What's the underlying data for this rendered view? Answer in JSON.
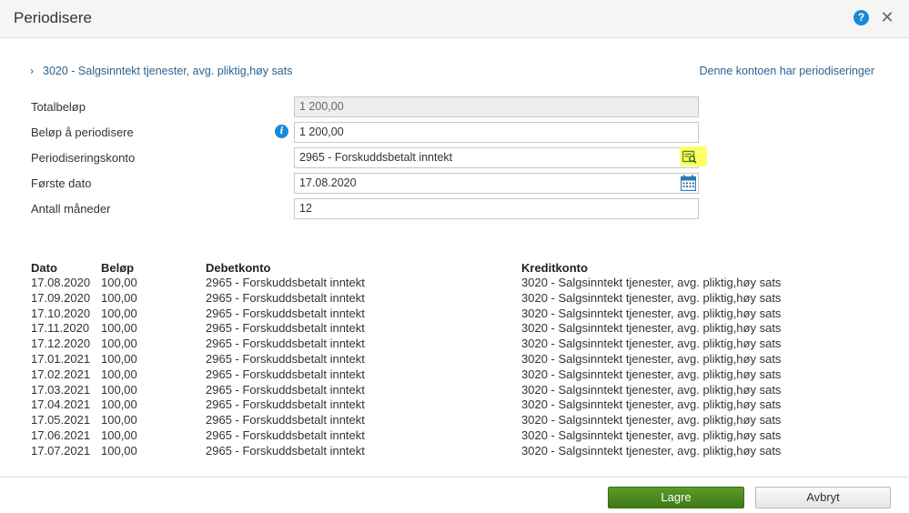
{
  "dialog": {
    "title": "Periodisere",
    "help_icon": "question-circle-icon",
    "close_icon": "close-icon"
  },
  "account": {
    "label": "3020 - Salgsinntekt tjenester, avg. pliktig,høy sats",
    "periodization_link": "Denne kontoen har periodiseringer"
  },
  "form": {
    "total_label": "Totalbeløp",
    "total_value": "1 200,00",
    "amount_label": "Beløp å periodisere",
    "amount_value": "1 200,00",
    "account_label": "Periodiseringskonto",
    "account_value": "2965 - Forskuddsbetalt inntekt",
    "first_date_label": "Første dato",
    "first_date_value": "17.08.2020",
    "months_label": "Antall måneder",
    "months_value": "12",
    "lookup_highlight_color": "#ffff66"
  },
  "table": {
    "headers": {
      "date": "Dato",
      "amount": "Beløp",
      "debit": "Debetkonto",
      "credit": "Kreditkonto"
    },
    "rows": [
      {
        "date": "17.08.2020",
        "amount": "100,00",
        "debit": "2965 - Forskuddsbetalt inntekt",
        "credit": "3020 - Salgsinntekt tjenester, avg. pliktig,høy sats"
      },
      {
        "date": "17.09.2020",
        "amount": "100,00",
        "debit": "2965 - Forskuddsbetalt inntekt",
        "credit": "3020 - Salgsinntekt tjenester, avg. pliktig,høy sats"
      },
      {
        "date": "17.10.2020",
        "amount": "100,00",
        "debit": "2965 - Forskuddsbetalt inntekt",
        "credit": "3020 - Salgsinntekt tjenester, avg. pliktig,høy sats"
      },
      {
        "date": "17.11.2020",
        "amount": "100,00",
        "debit": "2965 - Forskuddsbetalt inntekt",
        "credit": "3020 - Salgsinntekt tjenester, avg. pliktig,høy sats"
      },
      {
        "date": "17.12.2020",
        "amount": "100,00",
        "debit": "2965 - Forskuddsbetalt inntekt",
        "credit": "3020 - Salgsinntekt tjenester, avg. pliktig,høy sats"
      },
      {
        "date": "17.01.2021",
        "amount": "100,00",
        "debit": "2965 - Forskuddsbetalt inntekt",
        "credit": "3020 - Salgsinntekt tjenester, avg. pliktig,høy sats"
      },
      {
        "date": "17.02.2021",
        "amount": "100,00",
        "debit": "2965 - Forskuddsbetalt inntekt",
        "credit": "3020 - Salgsinntekt tjenester, avg. pliktig,høy sats"
      },
      {
        "date": "17.03.2021",
        "amount": "100,00",
        "debit": "2965 - Forskuddsbetalt inntekt",
        "credit": "3020 - Salgsinntekt tjenester, avg. pliktig,høy sats"
      },
      {
        "date": "17.04.2021",
        "amount": "100,00",
        "debit": "2965 - Forskuddsbetalt inntekt",
        "credit": "3020 - Salgsinntekt tjenester, avg. pliktig,høy sats"
      },
      {
        "date": "17.05.2021",
        "amount": "100,00",
        "debit": "2965 - Forskuddsbetalt inntekt",
        "credit": "3020 - Salgsinntekt tjenester, avg. pliktig,høy sats"
      },
      {
        "date": "17.06.2021",
        "amount": "100,00",
        "debit": "2965 - Forskuddsbetalt inntekt",
        "credit": "3020 - Salgsinntekt tjenester, avg. pliktig,høy sats"
      },
      {
        "date": "17.07.2021",
        "amount": "100,00",
        "debit": "2965 - Forskuddsbetalt inntekt",
        "credit": "3020 - Salgsinntekt tjenester, avg. pliktig,høy sats"
      }
    ]
  },
  "footer": {
    "save_label": "Lagre",
    "cancel_label": "Avbryt",
    "save_color": "#4a8a1f"
  }
}
